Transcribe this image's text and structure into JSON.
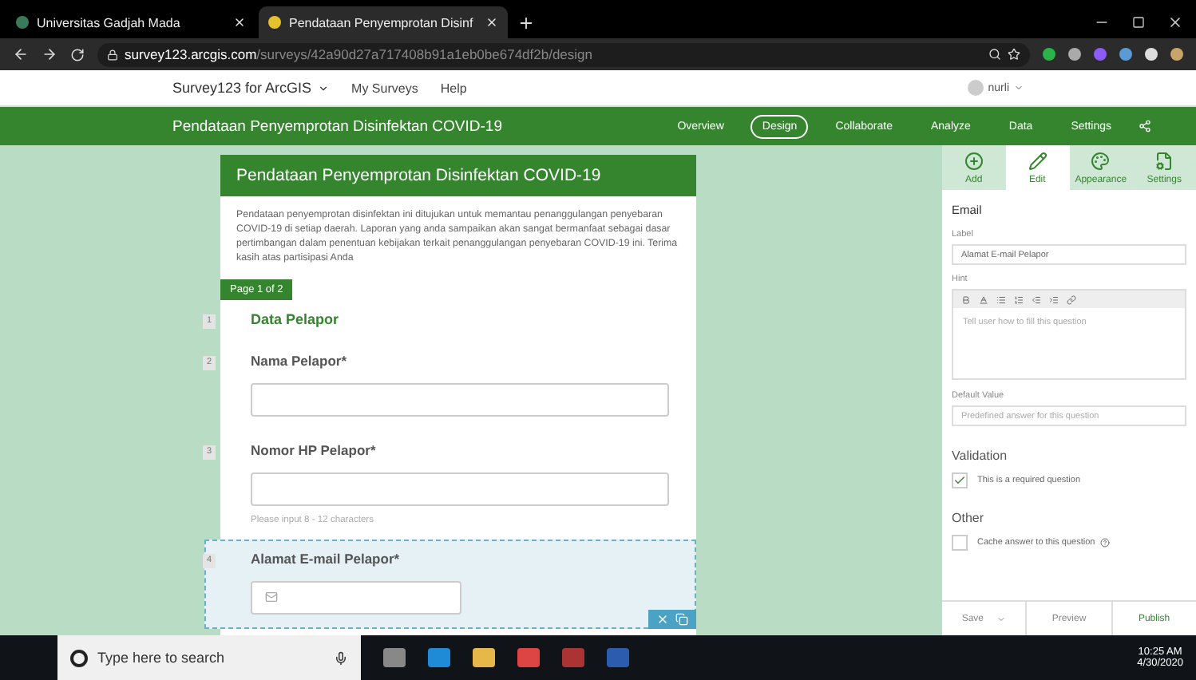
{
  "browser": {
    "tabs": [
      {
        "title": "Universitas Gadjah Mada",
        "selected": false
      },
      {
        "title": "Pendataan Penyemprotan Disinf",
        "selected": true
      }
    ],
    "url": {
      "host": "survey123.arcgis.com",
      "path": "/surveys/42a90d27a717408b91a1eb0be674df2b/design"
    }
  },
  "app_bar": {
    "product": "Survey123 for ArcGIS",
    "menu": [
      "My Surveys",
      "Help"
    ],
    "user": "nurli"
  },
  "header": {
    "title": "Pendataan Penyemprotan Disinfektan COVID-19",
    "nav": [
      {
        "label": "Overview",
        "selected": false
      },
      {
        "label": "Design",
        "selected": true
      },
      {
        "label": "Collaborate",
        "selected": false
      },
      {
        "label": "Analyze",
        "selected": false
      },
      {
        "label": "Data",
        "selected": false
      },
      {
        "label": "Settings",
        "selected": false
      }
    ]
  },
  "form": {
    "title": "Pendataan Penyemprotan Disinfektan COVID-19",
    "description": "Pendataan penyemprotan disinfektan ini ditujukan untuk memantau penanggulangan penyebaran COVID-19 di setiap daerah. Laporan yang anda sampaikan akan sangat bermanfaat sebagai dasar pertimbangan dalam penentuan kebijakan terkait penanggulangan penyebaran COVID-19 ini. Terima kasih atas partisipasi Anda",
    "page_label": "Page 1 of 2",
    "items": [
      {
        "number": "1",
        "kind": "heading",
        "label": "Data Pelapor",
        "selected": false
      },
      {
        "number": "2",
        "kind": "text",
        "label": "Nama Pelapor*",
        "selected": false
      },
      {
        "number": "3",
        "kind": "text",
        "label": "Nomor HP Pelapor*",
        "hint": "Please input 8 - 12 characters",
        "selected": false
      },
      {
        "number": "4",
        "kind": "email",
        "label": "Alamat E-mail Pelapor*",
        "selected": true
      }
    ]
  },
  "panel": {
    "tabs": [
      {
        "label": "Add",
        "selected": false
      },
      {
        "label": "Edit",
        "selected": true
      },
      {
        "label": "Appearance",
        "selected": false
      },
      {
        "label": "Settings",
        "selected": false
      }
    ],
    "section_title": "Email",
    "label_caption": "Label",
    "label_value": "Alamat E-mail Pelapor",
    "hint_caption": "Hint",
    "hint_placeholder": "Tell user how to fill this question",
    "default_caption": "Default Value",
    "default_placeholder": "Predefined answer for this question",
    "validation_title": "Validation",
    "required": {
      "label": "This is a required question",
      "checked": true
    },
    "other_title": "Other",
    "cache": {
      "label": "Cache answer to this question",
      "checked": false
    },
    "buttons": {
      "save": "Save",
      "preview": "Preview",
      "publish": "Publish"
    }
  },
  "taskbar": {
    "search_placeholder": "Type here to search",
    "time": "10:25 AM",
    "date": "4/30/2020"
  }
}
